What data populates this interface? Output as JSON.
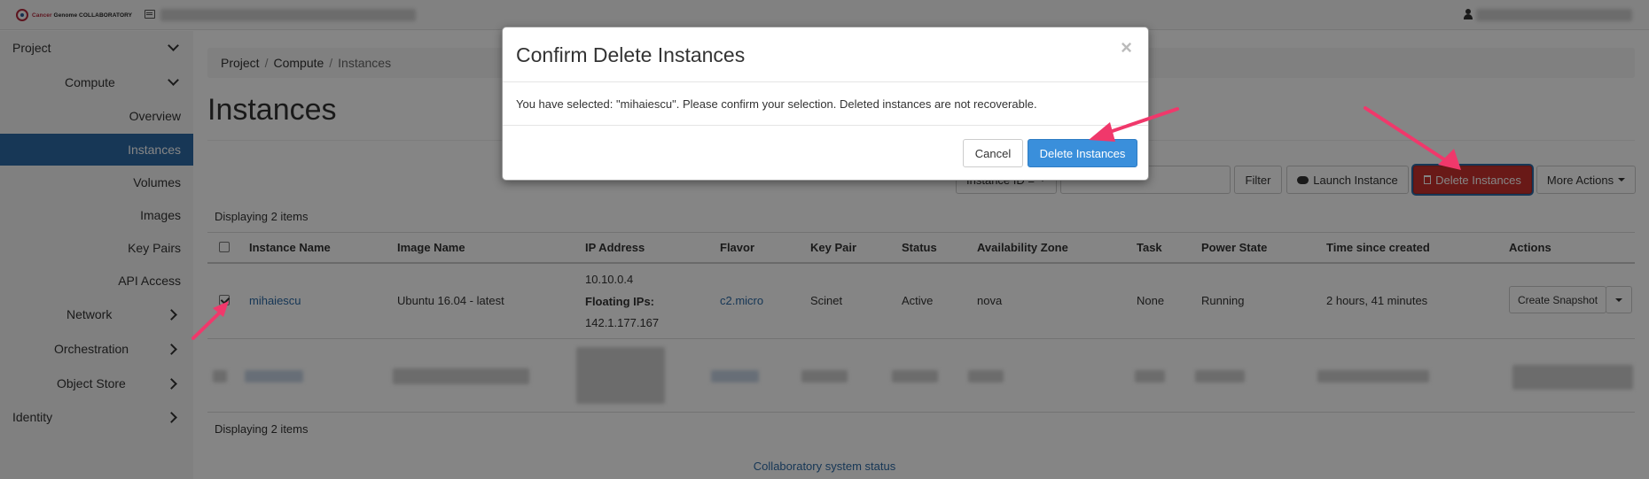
{
  "topbar": {
    "brand_prefix": "Cancer",
    "brand_suffix": "Genome COLLABORATORY"
  },
  "sidebar": {
    "items": [
      {
        "label": "Project"
      },
      {
        "label": "Compute"
      },
      {
        "label": "Overview"
      },
      {
        "label": "Instances"
      },
      {
        "label": "Volumes"
      },
      {
        "label": "Images"
      },
      {
        "label": "Key Pairs"
      },
      {
        "label": "API Access"
      },
      {
        "label": "Network"
      },
      {
        "label": "Orchestration"
      },
      {
        "label": "Object Store"
      },
      {
        "label": "Identity"
      }
    ]
  },
  "breadcrumb": {
    "items": [
      "Project",
      "Compute",
      "Instances"
    ],
    "separator": "/"
  },
  "page": {
    "title": "Instances"
  },
  "toolbar": {
    "filter_select": "Instance ID =",
    "filter_button": "Filter",
    "launch_button": "Launch Instance",
    "delete_button": "Delete Instances",
    "more_actions": "More Actions"
  },
  "table": {
    "display_count_top": "Displaying 2 items",
    "display_count_bottom": "Displaying 2 items",
    "headers": [
      "Instance Name",
      "Image Name",
      "IP Address",
      "Flavor",
      "Key Pair",
      "Status",
      "Availability Zone",
      "Task",
      "Power State",
      "Time since created",
      "Actions"
    ],
    "rows": [
      {
        "name": "mihaiescu",
        "image": "Ubuntu 16.04 - latest",
        "ip": "10.10.0.4",
        "floating_label": "Floating IPs:",
        "floating_ip": "142.1.177.167",
        "flavor": "c2.micro",
        "key_pair": "Scinet",
        "status": "Active",
        "zone": "nova",
        "task": "None",
        "power": "Running",
        "age": "2 hours, 41 minutes",
        "action": "Create Snapshot",
        "checked": true
      }
    ]
  },
  "footer": {
    "status_link": "Collaboratory system status"
  },
  "modal": {
    "title": "Confirm Delete Instances",
    "close": "×",
    "body": "You have selected: \"mihaiescu\". Please confirm your selection. Deleted instances are not recoverable.",
    "cancel_button": "Cancel",
    "confirm_button": "Delete Instances"
  },
  "colors": {
    "accent": "#2c6aa6",
    "danger": "#c9302c",
    "primary": "#3a8fdb",
    "annotation_arrow": "#f0386b"
  }
}
